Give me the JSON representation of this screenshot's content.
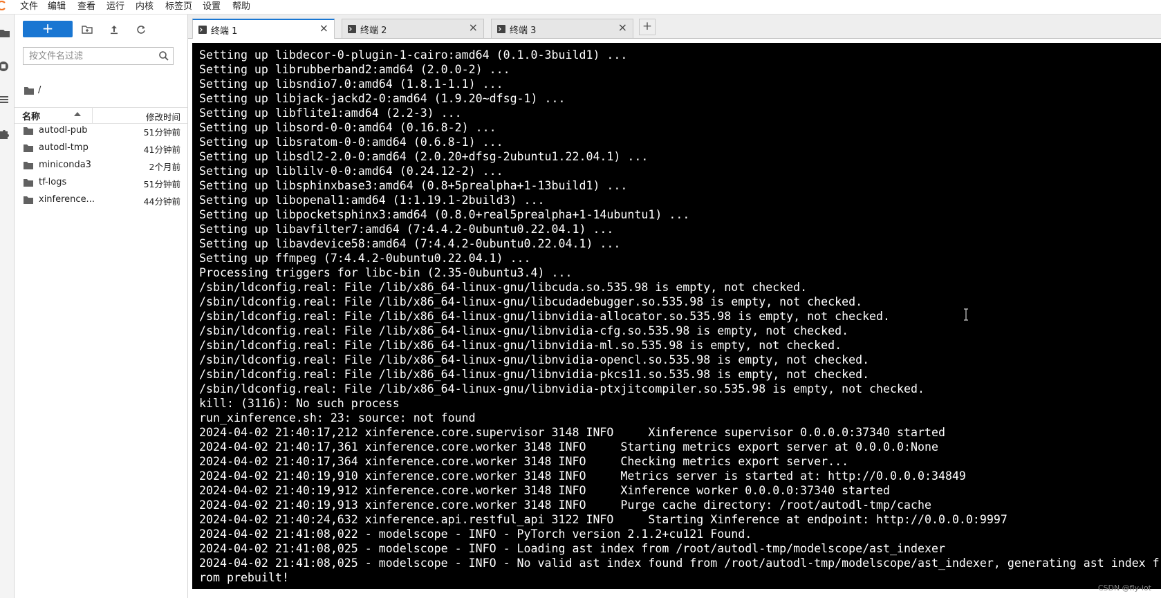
{
  "menu": {
    "items": [
      "文件",
      "编辑",
      "查看",
      "运行",
      "内核",
      "标签页",
      "设置",
      "帮助"
    ]
  },
  "rail": {
    "icons": [
      "folder-icon",
      "stop-circle-icon",
      "list-icon",
      "extension-icon"
    ]
  },
  "filebrowser": {
    "new_label": "+",
    "filter_placeholder": "按文件名过滤",
    "breadcrumb": "/",
    "col_name": "名称",
    "col_modified": "修改时间",
    "rows": [
      {
        "name": "autodl-pub",
        "modified": "51分钟前"
      },
      {
        "name": "autodl-tmp",
        "modified": "41分钟前"
      },
      {
        "name": "miniconda3",
        "modified": "2个月前"
      },
      {
        "name": "tf-logs",
        "modified": "51分钟前"
      },
      {
        "name": "xinference...",
        "modified": "44分钟前"
      }
    ]
  },
  "tabs": [
    {
      "label": "终端 1",
      "active": true,
      "close": "×"
    },
    {
      "label": "终端 2",
      "active": false,
      "close": "×"
    },
    {
      "label": "终端 3",
      "active": false,
      "close": "×"
    }
  ],
  "add_tab": "+",
  "terminal": {
    "lines": [
      "Setting up libdecor-0-plugin-1-cairo:amd64 (0.1.0-3build1) ...",
      "Setting up librubberband2:amd64 (2.0.0-2) ...",
      "Setting up libsndio7.0:amd64 (1.8.1-1.1) ...",
      "Setting up libjack-jackd2-0:amd64 (1.9.20~dfsg-1) ...",
      "Setting up libflite1:amd64 (2.2-3) ...",
      "Setting up libsord-0-0:amd64 (0.16.8-2) ...",
      "Setting up libsratom-0-0:amd64 (0.6.8-1) ...",
      "Setting up libsdl2-2.0-0:amd64 (2.0.20+dfsg-2ubuntu1.22.04.1) ...",
      "Setting up liblilv-0-0:amd64 (0.24.12-2) ...",
      "Setting up libsphinxbase3:amd64 (0.8+5prealpha+1-13build1) ...",
      "Setting up libopenal1:amd64 (1:1.19.1-2build3) ...",
      "Setting up libpocketsphinx3:amd64 (0.8.0+real5prealpha+1-14ubuntu1) ...",
      "Setting up libavfilter7:amd64 (7:4.4.2-0ubuntu0.22.04.1) ...",
      "Setting up libavdevice58:amd64 (7:4.4.2-0ubuntu0.22.04.1) ...",
      "Setting up ffmpeg (7:4.4.2-0ubuntu0.22.04.1) ...",
      "Processing triggers for libc-bin (2.35-0ubuntu3.4) ...",
      "/sbin/ldconfig.real: File /lib/x86_64-linux-gnu/libcuda.so.535.98 is empty, not checked.",
      "/sbin/ldconfig.real: File /lib/x86_64-linux-gnu/libcudadebugger.so.535.98 is empty, not checked.",
      "/sbin/ldconfig.real: File /lib/x86_64-linux-gnu/libnvidia-allocator.so.535.98 is empty, not checked.",
      "/sbin/ldconfig.real: File /lib/x86_64-linux-gnu/libnvidia-cfg.so.535.98 is empty, not checked.",
      "/sbin/ldconfig.real: File /lib/x86_64-linux-gnu/libnvidia-ml.so.535.98 is empty, not checked.",
      "/sbin/ldconfig.real: File /lib/x86_64-linux-gnu/libnvidia-opencl.so.535.98 is empty, not checked.",
      "/sbin/ldconfig.real: File /lib/x86_64-linux-gnu/libnvidia-pkcs11.so.535.98 is empty, not checked.",
      "/sbin/ldconfig.real: File /lib/x86_64-linux-gnu/libnvidia-ptxjitcompiler.so.535.98 is empty, not checked.",
      "kill: (3116): No such process",
      "run_xinference.sh: 23: source: not found",
      "2024-04-02 21:40:17,212 xinference.core.supervisor 3148 INFO     Xinference supervisor 0.0.0.0:37340 started",
      "2024-04-02 21:40:17,361 xinference.core.worker 3148 INFO     Starting metrics export server at 0.0.0.0:None",
      "2024-04-02 21:40:17,364 xinference.core.worker 3148 INFO     Checking metrics export server...",
      "2024-04-02 21:40:19,910 xinference.core.worker 3148 INFO     Metrics server is started at: http://0.0.0.0:34849",
      "2024-04-02 21:40:19,912 xinference.core.worker 3148 INFO     Xinference worker 0.0.0.0:37340 started",
      "2024-04-02 21:40:19,913 xinference.core.worker 3148 INFO     Purge cache directory: /root/autodl-tmp/cache",
      "2024-04-02 21:40:24,632 xinference.api.restful_api 3122 INFO     Starting Xinference at endpoint: http://0.0.0.0:9997",
      "2024-04-02 21:41:08,022 - modelscope - INFO - PyTorch version 2.1.2+cu121 Found.",
      "2024-04-02 21:41:08,025 - modelscope - INFO - Loading ast index from /root/autodl-tmp/modelscope/ast_indexer",
      "2024-04-02 21:41:08,025 - modelscope - INFO - No valid ast index found from /root/autodl-tmp/modelscope/ast_indexer, generating ast index f",
      "rom prebuilt!"
    ]
  },
  "watermark": "CSDN @fly-iot",
  "colors": {
    "accent": "#1976d2",
    "terminal_bg": "#000000",
    "terminal_fg": "#ffffff",
    "logo": "#f37626"
  }
}
